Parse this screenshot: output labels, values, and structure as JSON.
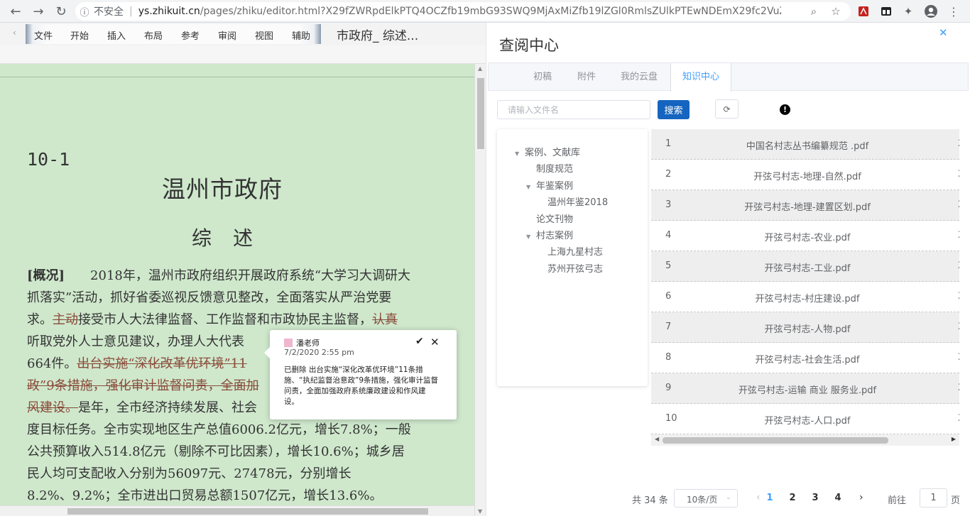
{
  "browser": {
    "security_label": "不安全",
    "url_host": "ys.zhikuit.cn",
    "url_rest": "/pages/zhiku/editor.html?X29fZWRpdElkPTQ4OCZfb19mbG93SWQ9MjAxMiZfb19lZGl0RmlsZUlkPTEwNDEmX29fc2VuZElkP..."
  },
  "editor": {
    "menu": [
      "文件",
      "开始",
      "插入",
      "布局",
      "参考",
      "审阅",
      "视图",
      "辅助"
    ],
    "doc_name": "市政府_ 综述...",
    "doc_number": "10-1",
    "doc_title": "温州市政府",
    "doc_subtitle": "综述",
    "lines": [
      {
        "parts": [
          {
            "t": "[概况]",
            "s": "bold"
          },
          {
            "t": "　　2018年，温州市政府组织开展政府系统“大学习大调研大",
            "s": ""
          }
        ]
      },
      {
        "parts": [
          {
            "t": "抓落实”活动，抓好省委巡视反馈意见整改，全面落实从严治党要",
            "s": ""
          }
        ]
      },
      {
        "parts": [
          {
            "t": "求。",
            "s": ""
          },
          {
            "t": "主动",
            "s": "del"
          },
          {
            "t": "接受市人大法律监督、工作监督和市政协民主监督，",
            "s": ""
          },
          {
            "t": "认真",
            "s": "del"
          }
        ]
      },
      {
        "parts": [
          {
            "t": "听取党外人士意见建议，办理人大代表",
            "s": ""
          }
        ]
      },
      {
        "parts": [
          {
            "t": "664件。",
            "s": ""
          },
          {
            "t": "出台实施“深化改革优环境”11",
            "s": "del"
          }
        ]
      },
      {
        "parts": [
          {
            "t": "政”9条措施，强化审计监督问责，全面加",
            "s": "del"
          }
        ]
      },
      {
        "parts": [
          {
            "t": "风建设。",
            "s": "del"
          },
          {
            "t": "是年，全市经济持续发展、社会",
            "s": ""
          }
        ]
      },
      {
        "parts": [
          {
            "t": "度目标任务。全市实现地区生产总值6006.2亿元，增长7.8%；一般",
            "s": ""
          }
        ]
      },
      {
        "parts": [
          {
            "t": "公共预算收入514.8亿元（剔除不可比因素），增长10.6%；城乡居",
            "s": ""
          }
        ]
      },
      {
        "parts": [
          {
            "t": "民人均可支配收入分别为56097元、27478元，分别增长",
            "s": ""
          }
        ]
      },
      {
        "parts": [
          {
            "t": "8.2%、9.2%；全市进出口贸易总额1507亿元，增长13.6%。",
            "s": ""
          }
        ]
      }
    ]
  },
  "comment": {
    "author": "潘老师",
    "time": "7/2/2020 2:55 pm",
    "body": "已删除 出台实施“深化改革优环境”11条措施、“执纪监督治意政”9条措施，强化审计监督问责，全面加强政府系统廉政建设和作风建设。",
    "accept_icon": "check-icon",
    "reject_icon": "close-icon"
  },
  "panel": {
    "title": "查阅中心",
    "tabs": [
      {
        "label": "初稿",
        "active": false
      },
      {
        "label": "附件",
        "active": false
      },
      {
        "label": "我的云盘",
        "active": false
      },
      {
        "label": "知识中心",
        "active": true
      }
    ],
    "search_placeholder": "请输入文件名",
    "search_value": "",
    "search_button": "搜索",
    "tree": [
      {
        "label": "案例、文献库",
        "level": 0,
        "expanded": true
      },
      {
        "label": "制度规范",
        "level": 1,
        "expanded": null
      },
      {
        "label": "年鉴案例",
        "level": 1,
        "expanded": true
      },
      {
        "label": "温州年鉴2018",
        "level": 2,
        "expanded": null
      },
      {
        "label": "论文刊物",
        "level": 1,
        "expanded": null
      },
      {
        "label": "村志案例",
        "level": 1,
        "expanded": true
      },
      {
        "label": "上海九星村志",
        "level": 2,
        "expanded": null
      },
      {
        "label": "苏州开弦弓志",
        "level": 2,
        "expanded": null
      }
    ],
    "files": [
      {
        "idx": "1",
        "name": "中国名村志丛书编纂规范 .pdf",
        "cut": "2"
      },
      {
        "idx": "2",
        "name": "开弦弓村志-地理-自然.pdf",
        "cut": "2"
      },
      {
        "idx": "3",
        "name": "开弦弓村志-地理-建置区划.pdf",
        "cut": "2"
      },
      {
        "idx": "4",
        "name": "开弦弓村志-农业.pdf",
        "cut": "2"
      },
      {
        "idx": "5",
        "name": "开弦弓村志-工业.pdf",
        "cut": "2"
      },
      {
        "idx": "6",
        "name": "开弦弓村志-村庄建设.pdf",
        "cut": "2"
      },
      {
        "idx": "7",
        "name": "开弦弓村志-人物.pdf",
        "cut": "2"
      },
      {
        "idx": "8",
        "name": "开弦弓村志-社会生活.pdf",
        "cut": "2"
      },
      {
        "idx": "9",
        "name": "开弦弓村志-运输 商业 服务业.pdf",
        "cut": "2"
      },
      {
        "idx": "10",
        "name": "开弦弓村志-人口.pdf",
        "cut": "2"
      }
    ],
    "pager": {
      "total": "共 34 条",
      "page_size": "10条/页",
      "pages": [
        "1",
        "2",
        "3",
        "4"
      ],
      "current": "1",
      "goto_label": "前往",
      "goto_value": "1",
      "page_word": "页"
    }
  }
}
